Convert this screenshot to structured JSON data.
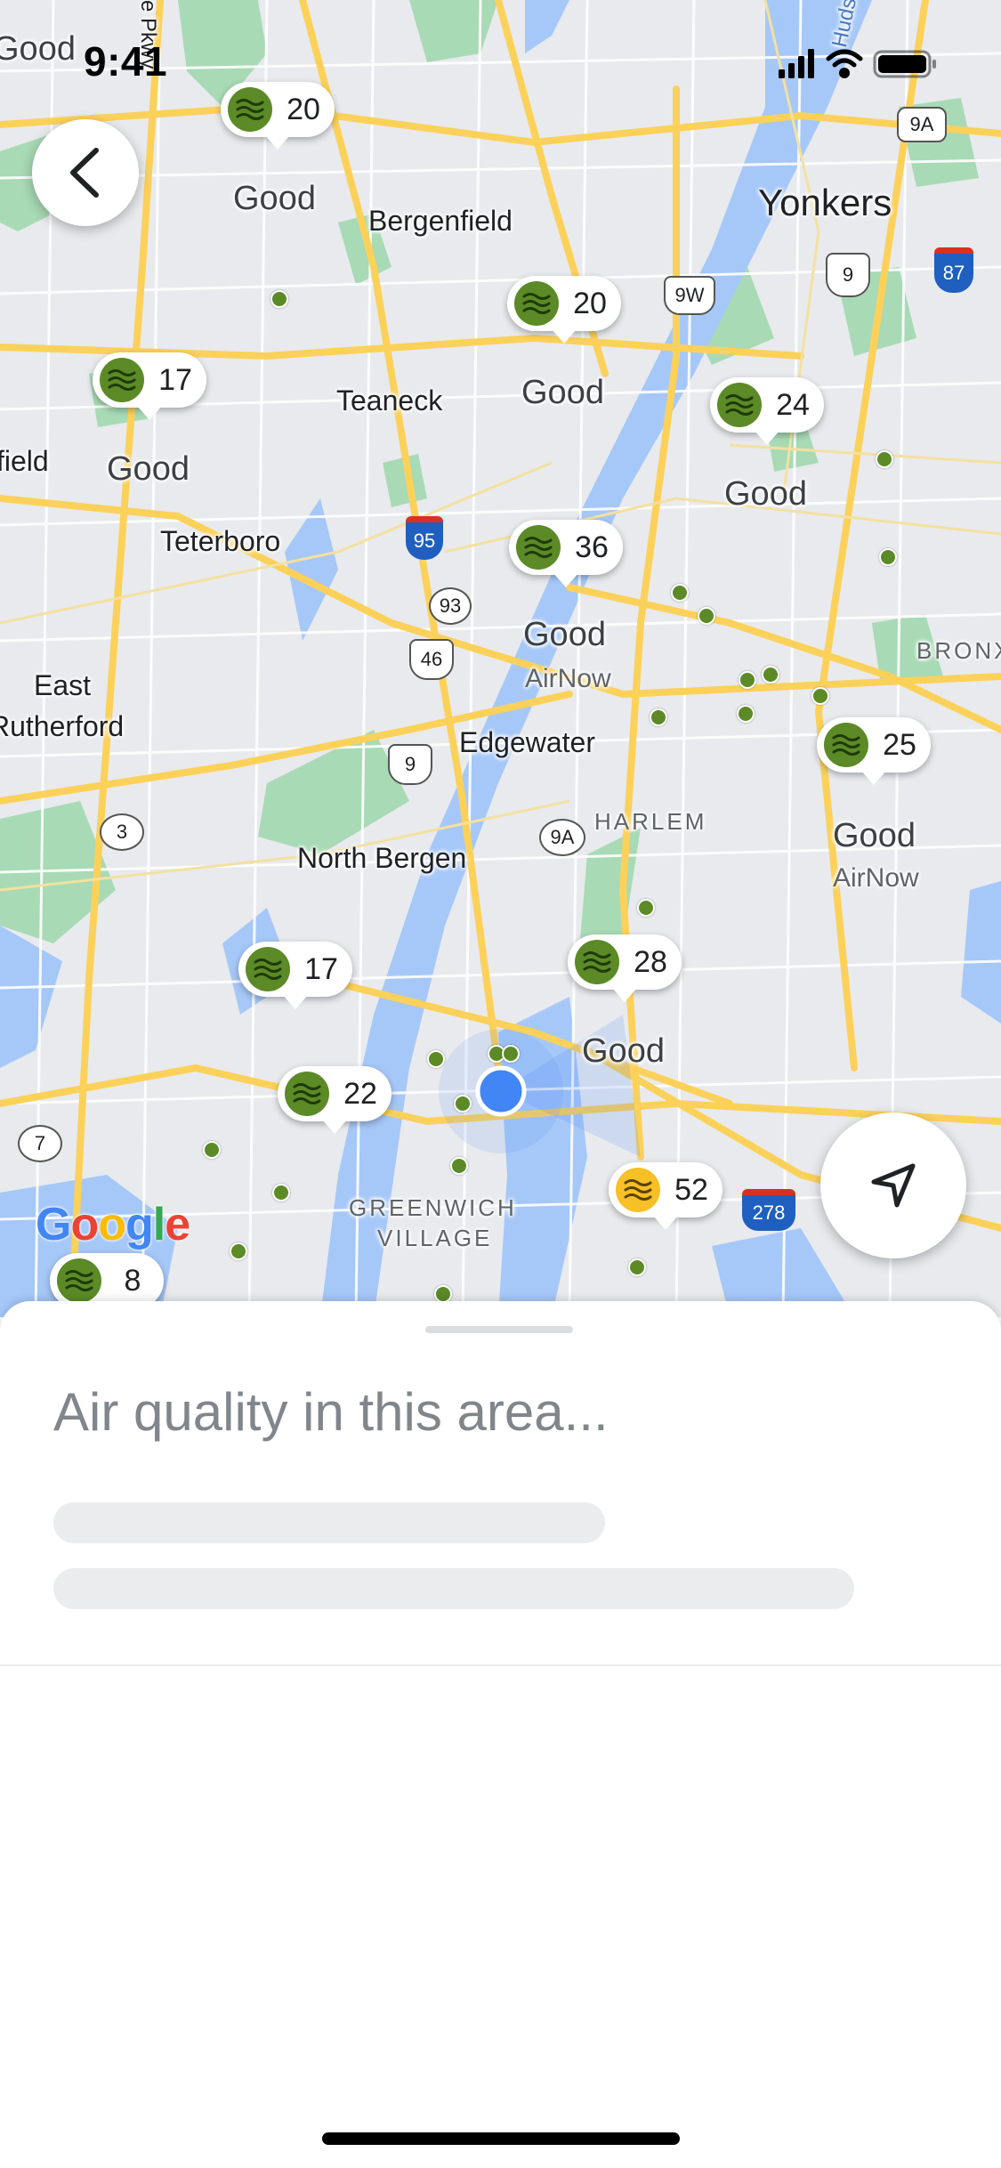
{
  "status_bar": {
    "time": "9:41"
  },
  "map": {
    "readings": [
      {
        "value": "20",
        "level": "good"
      },
      {
        "value": "20",
        "level": "good"
      },
      {
        "value": "17",
        "level": "good"
      },
      {
        "value": "24",
        "level": "good"
      },
      {
        "value": "36",
        "level": "good"
      },
      {
        "value": "25",
        "level": "good"
      },
      {
        "value": "17",
        "level": "good"
      },
      {
        "value": "28",
        "level": "good"
      },
      {
        "value": "22",
        "level": "good"
      },
      {
        "value": "52",
        "level": "moderate"
      },
      {
        "value": "8",
        "level": "good"
      }
    ],
    "quality_labels": [
      "Good",
      "Good",
      "Good",
      "Good",
      "Good",
      "Good",
      "Good",
      "Good"
    ],
    "partial_labels": [
      "Good",
      "field"
    ],
    "source_labels": [
      "AirNow",
      "AirNow"
    ],
    "places": {
      "bergenfield": "Bergenfield",
      "yonkers": "Yonkers",
      "teaneck": "Teaneck",
      "teterboro": "Teterboro",
      "east": "East",
      "rutherford": "Rutherford",
      "edgewater": "Edgewater",
      "north_bergen": "North Bergen",
      "bronx": "BRONX",
      "harlem": "HARLEM",
      "greenwich1": "GREENWICH",
      "greenwich2": "VILLAGE",
      "pkwy": "e Pkwy",
      "hudson": "Hudson"
    },
    "route_shields": [
      "9A",
      "9",
      "87",
      "9W",
      "95",
      "93",
      "46",
      "9",
      "9A",
      "3",
      "7",
      "278"
    ],
    "logo": "Google",
    "colors": {
      "good": "#5b8a26",
      "moderate": "#f6c026",
      "water": "#a6c8f8",
      "park": "#a8dab5",
      "road": "#fcd15a",
      "user": "#4285f4"
    }
  },
  "buttons": {
    "back": "back",
    "locate": "my-location"
  },
  "sheet": {
    "title": "Air quality in this area..."
  }
}
